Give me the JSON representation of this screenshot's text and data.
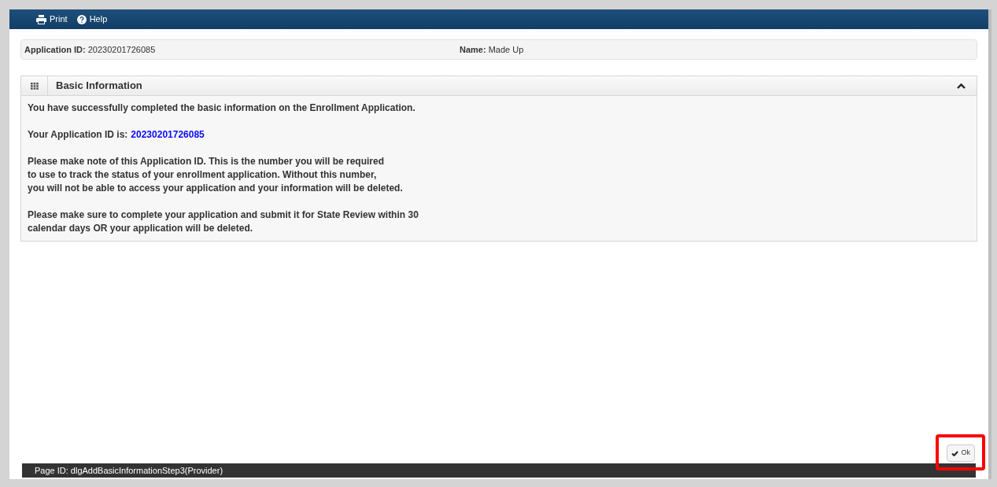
{
  "toolbar": {
    "items": [
      {
        "kind": "print",
        "label": "Print"
      },
      {
        "kind": "help",
        "label": "Help"
      }
    ]
  },
  "summary": {
    "fields": [
      {
        "label": "Application ID:",
        "value": "20230201726085"
      },
      {
        "label": "Name:",
        "value": "Made Up"
      }
    ]
  },
  "panel": {
    "title": "Basic Information",
    "expanded": true,
    "intro": "You have successfully completed the basic information on the Enrollment Application.",
    "id_label": "Your Application ID is:",
    "id_value": "20230201726085",
    "paragraphs": [
      [
        "Please make note of this Application ID. This is the number you will be required",
        "to use to track the status of your enrollment application. Without this number,",
        "you will not be able to access your application and your information will be deleted."
      ],
      [
        "Please make sure to complete your application and submit it for State Review within 30",
        "calendar days OR your application will be deleted."
      ]
    ]
  },
  "ok_button": {
    "label": "Ok",
    "highlighted": true
  },
  "footer": {
    "page_id": "Page ID: dlgAddBasicInformationStep3(Provider)"
  }
}
